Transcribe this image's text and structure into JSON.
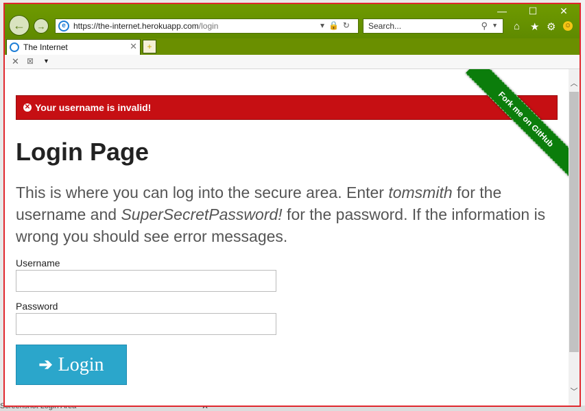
{
  "browser": {
    "url_host": "https://the-internet.herokuapp.com",
    "url_path": "/login",
    "search_placeholder": "Search...",
    "tab_title": "The Internet"
  },
  "background": {
    "snippet_text": "Screenshot Login Area"
  },
  "page": {
    "flash_message": "Your username is invalid!",
    "ribbon_text": "Fork me on GitHub",
    "title": "Login Page",
    "intro_part1": "This is where you can log into the secure area. Enter ",
    "intro_username": "tomsmith",
    "intro_part2": " for the username and ",
    "intro_password": "SuperSecretPassword!",
    "intro_part3": " for the password. If the information is wrong you should see error messages.",
    "username_label": "Username",
    "password_label": "Password",
    "username_value": "",
    "password_value": "",
    "login_button_label": "Login"
  },
  "colors": {
    "browser_chrome": "#6a8f00",
    "flash_error": "#c60f13",
    "ribbon": "#0b7d0b",
    "button": "#2ba6cb",
    "window_border": "#e0262c"
  }
}
